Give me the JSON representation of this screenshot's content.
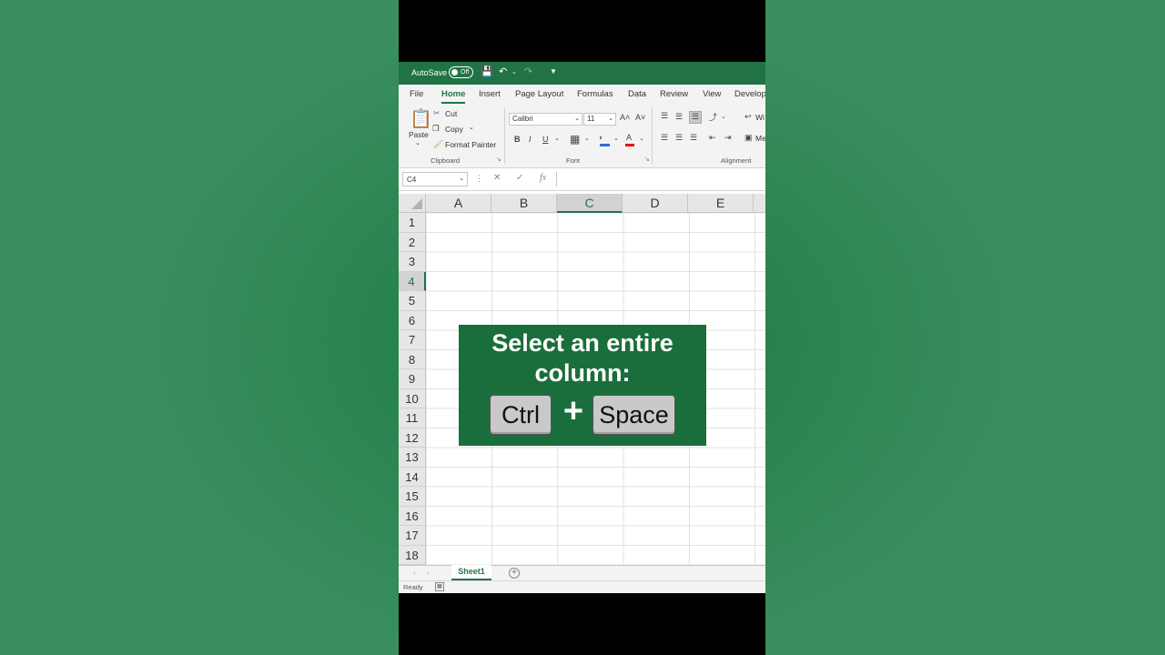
{
  "titlebar": {
    "autosave": "AutoSave",
    "toggle": "Off"
  },
  "tabs": [
    "File",
    "Home",
    "Insert",
    "Page Layout",
    "Formulas",
    "Data",
    "Review",
    "View",
    "Develop"
  ],
  "clipboard": {
    "paste": "Paste",
    "cut": "Cut",
    "copy": "Copy",
    "format_painter": "Format Painter",
    "label": "Clipboard"
  },
  "font": {
    "name": "Calibri",
    "size": "11",
    "bold": "B",
    "italic": "I",
    "underline": "U",
    "grow": "A˄",
    "shrink": "A˅",
    "label": "Font",
    "font_color": "A"
  },
  "alignment": {
    "wrap": "Wi",
    "merge": "Me",
    "label": "Alignment"
  },
  "formulabar": {
    "namebox": "C4",
    "fx": "fx",
    "formula": ""
  },
  "columns": [
    "A",
    "B",
    "C",
    "D",
    "E"
  ],
  "rows": [
    "1",
    "2",
    "3",
    "4",
    "5",
    "6",
    "7",
    "8",
    "9",
    "10",
    "11",
    "12",
    "13",
    "14",
    "15",
    "16",
    "17",
    "18"
  ],
  "active_cell": {
    "column": "C",
    "row": "4"
  },
  "sheets": {
    "tab": "Sheet1",
    "add": "+"
  },
  "statusbar": {
    "ready": "Ready"
  },
  "overlay": {
    "line1": "Select an entire",
    "line2": "column:",
    "key1": "Ctrl",
    "plus": "+",
    "key2": "Space"
  },
  "colors": {
    "excel_green": "#217346",
    "overlay_green": "#1a6e3b",
    "background_green": "#2a8450"
  }
}
